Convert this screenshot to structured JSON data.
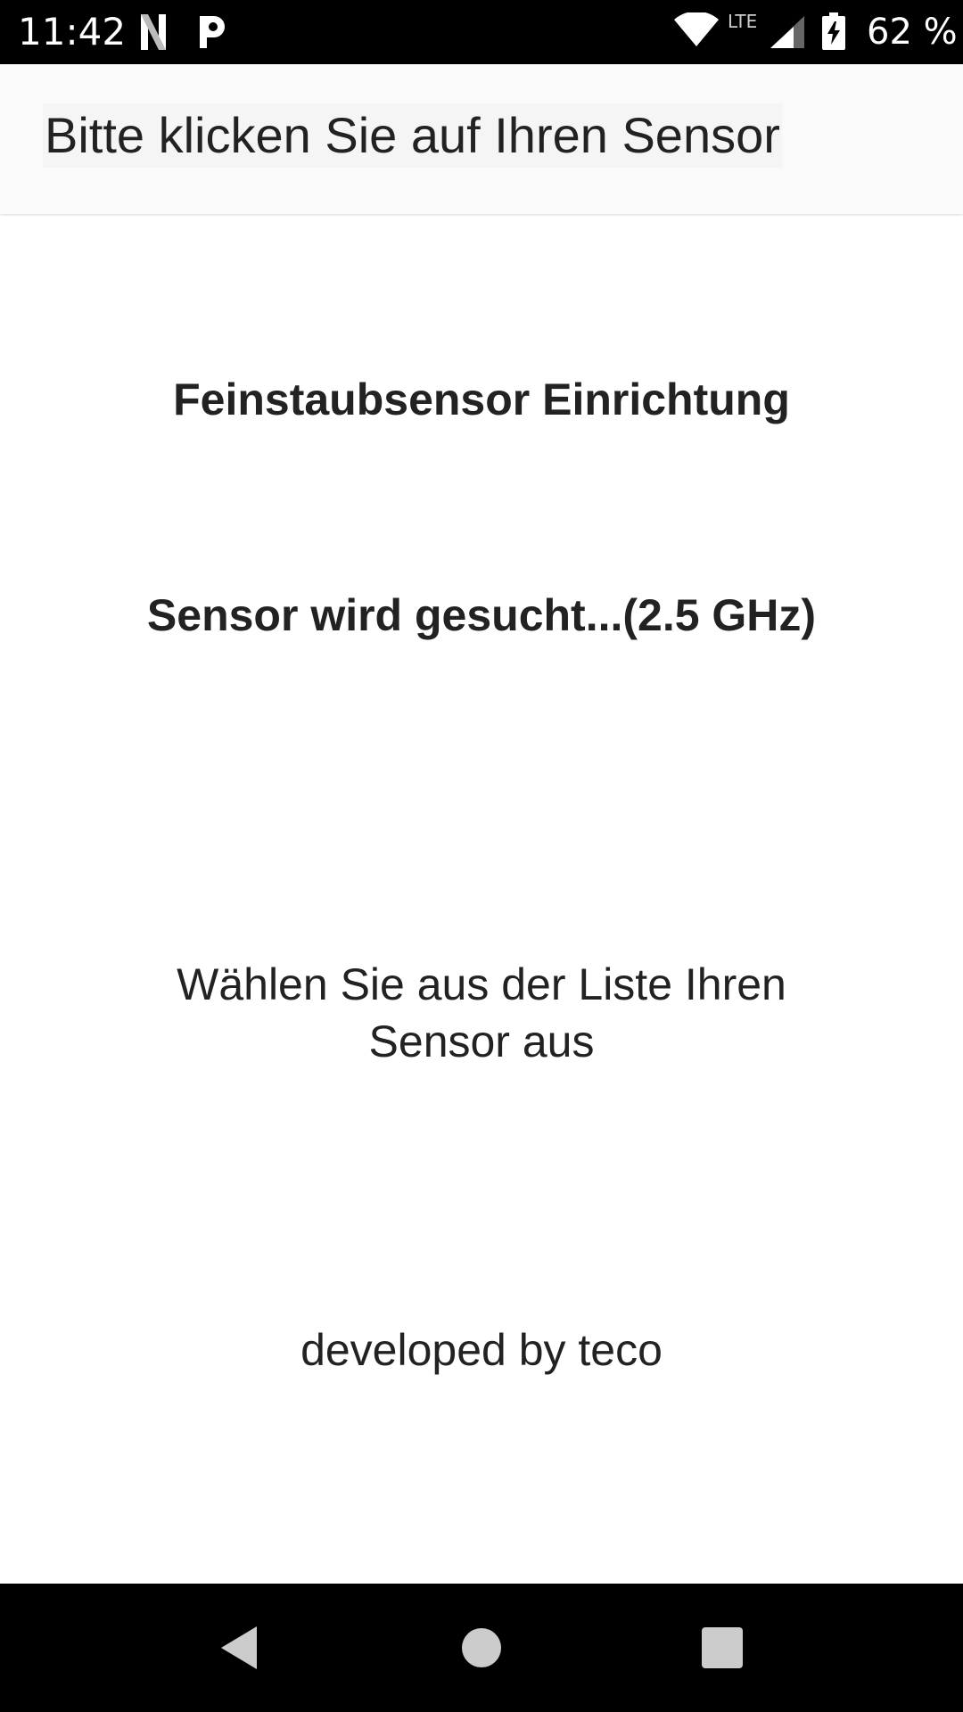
{
  "status_bar": {
    "time": "11:42",
    "notification_icons": [
      "netflix-icon",
      "parking-icon"
    ],
    "network_type": "LTE",
    "battery_percent": "62 %",
    "battery_level": 0.62
  },
  "app_bar": {
    "title": "Bitte klicken Sie auf Ihren Sensor"
  },
  "main": {
    "heading": "Feinstaubsensor Einrichtung",
    "search_status": "Sensor wird gesucht...(2.5 GHz)",
    "instruction": "Wählen Sie aus der Liste Ihren Sensor aus",
    "credit": "developed by teco"
  },
  "navigation": {
    "buttons": [
      "back-icon",
      "home-icon",
      "recents-icon"
    ]
  },
  "colors": {
    "status_bar_bg": "#000000",
    "app_bar_bg": "#fafafa",
    "text": "#222222",
    "nav_icon": "#cccccc"
  }
}
